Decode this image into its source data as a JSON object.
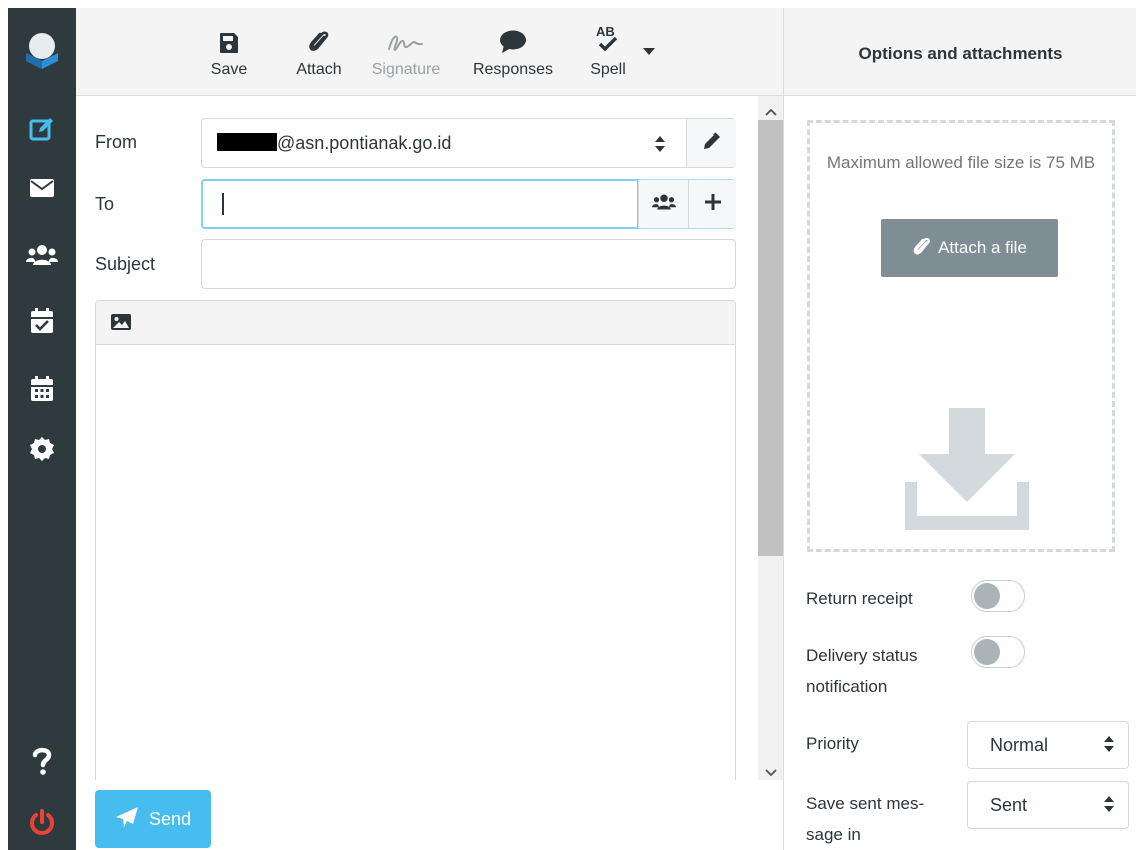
{
  "toolbar": {
    "save_label": "Save",
    "attach_label": "Attach",
    "signature_label": "Signature",
    "responses_label": "Responses",
    "spell_label": "Spell"
  },
  "form": {
    "from_label": "From",
    "from_value": "@asn.pontianak.go.id",
    "to_label": "To",
    "to_value": "",
    "subject_label": "Subject",
    "subject_value": ""
  },
  "send_label": "Send",
  "options": {
    "title": "Options and attachments",
    "max_size_text": "Maximum allowed file size is 75 MB",
    "attach_file_label": "Attach a file",
    "return_receipt_label": "Return receipt",
    "return_receipt_on": false,
    "dsn_label_line1": "Delivery status",
    "dsn_label_line2": "notification",
    "dsn_on": false,
    "priority_label": "Priority",
    "priority_value": "Normal",
    "save_sent_label_line1": "Save sent mes-",
    "save_sent_label_line2": "sage in",
    "save_sent_value": "Sent"
  },
  "colors": {
    "rail": "#2f3a3f",
    "accent": "#47bcef",
    "logout": "#ea4335"
  },
  "icons": {
    "rail": [
      "logo-icon",
      "compose-icon",
      "mail-icon",
      "contacts-icon",
      "tasks-icon",
      "calendar-icon",
      "settings-icon",
      "help-icon",
      "power-icon"
    ],
    "toolbar": [
      "save-icon",
      "paperclip-icon",
      "signature-icon",
      "speech-bubble-icon",
      "spellcheck-icon",
      "caret-down-icon"
    ]
  }
}
